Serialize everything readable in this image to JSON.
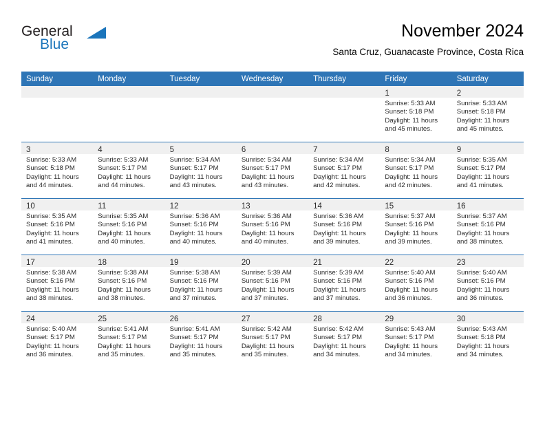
{
  "brand": {
    "name_part1": "General",
    "name_part2": "Blue",
    "color_primary": "#1b75bb",
    "color_text": "#231f20",
    "triangle_icon": "triangle-icon"
  },
  "header": {
    "title": "November 2024",
    "subtitle": "Santa Cruz, Guanacaste Province, Costa Rica"
  },
  "theme": {
    "header_bg": "#2e75b6",
    "header_text": "#ffffff",
    "daynum_band_bg": "#f0f0f0",
    "cell_bg": "#ffffff",
    "cell_border": "#2e75b6"
  },
  "weekdays": [
    "Sunday",
    "Monday",
    "Tuesday",
    "Wednesday",
    "Thursday",
    "Friday",
    "Saturday"
  ],
  "weeks": [
    [
      {
        "day": "",
        "lines": []
      },
      {
        "day": "",
        "lines": []
      },
      {
        "day": "",
        "lines": []
      },
      {
        "day": "",
        "lines": []
      },
      {
        "day": "",
        "lines": []
      },
      {
        "day": "1",
        "lines": [
          "Sunrise: 5:33 AM",
          "Sunset: 5:18 PM",
          "Daylight: 11 hours",
          "and 45 minutes."
        ]
      },
      {
        "day": "2",
        "lines": [
          "Sunrise: 5:33 AM",
          "Sunset: 5:18 PM",
          "Daylight: 11 hours",
          "and 45 minutes."
        ]
      }
    ],
    [
      {
        "day": "3",
        "lines": [
          "Sunrise: 5:33 AM",
          "Sunset: 5:18 PM",
          "Daylight: 11 hours",
          "and 44 minutes."
        ]
      },
      {
        "day": "4",
        "lines": [
          "Sunrise: 5:33 AM",
          "Sunset: 5:17 PM",
          "Daylight: 11 hours",
          "and 44 minutes."
        ]
      },
      {
        "day": "5",
        "lines": [
          "Sunrise: 5:34 AM",
          "Sunset: 5:17 PM",
          "Daylight: 11 hours",
          "and 43 minutes."
        ]
      },
      {
        "day": "6",
        "lines": [
          "Sunrise: 5:34 AM",
          "Sunset: 5:17 PM",
          "Daylight: 11 hours",
          "and 43 minutes."
        ]
      },
      {
        "day": "7",
        "lines": [
          "Sunrise: 5:34 AM",
          "Sunset: 5:17 PM",
          "Daylight: 11 hours",
          "and 42 minutes."
        ]
      },
      {
        "day": "8",
        "lines": [
          "Sunrise: 5:34 AM",
          "Sunset: 5:17 PM",
          "Daylight: 11 hours",
          "and 42 minutes."
        ]
      },
      {
        "day": "9",
        "lines": [
          "Sunrise: 5:35 AM",
          "Sunset: 5:17 PM",
          "Daylight: 11 hours",
          "and 41 minutes."
        ]
      }
    ],
    [
      {
        "day": "10",
        "lines": [
          "Sunrise: 5:35 AM",
          "Sunset: 5:16 PM",
          "Daylight: 11 hours",
          "and 41 minutes."
        ]
      },
      {
        "day": "11",
        "lines": [
          "Sunrise: 5:35 AM",
          "Sunset: 5:16 PM",
          "Daylight: 11 hours",
          "and 40 minutes."
        ]
      },
      {
        "day": "12",
        "lines": [
          "Sunrise: 5:36 AM",
          "Sunset: 5:16 PM",
          "Daylight: 11 hours",
          "and 40 minutes."
        ]
      },
      {
        "day": "13",
        "lines": [
          "Sunrise: 5:36 AM",
          "Sunset: 5:16 PM",
          "Daylight: 11 hours",
          "and 40 minutes."
        ]
      },
      {
        "day": "14",
        "lines": [
          "Sunrise: 5:36 AM",
          "Sunset: 5:16 PM",
          "Daylight: 11 hours",
          "and 39 minutes."
        ]
      },
      {
        "day": "15",
        "lines": [
          "Sunrise: 5:37 AM",
          "Sunset: 5:16 PM",
          "Daylight: 11 hours",
          "and 39 minutes."
        ]
      },
      {
        "day": "16",
        "lines": [
          "Sunrise: 5:37 AM",
          "Sunset: 5:16 PM",
          "Daylight: 11 hours",
          "and 38 minutes."
        ]
      }
    ],
    [
      {
        "day": "17",
        "lines": [
          "Sunrise: 5:38 AM",
          "Sunset: 5:16 PM",
          "Daylight: 11 hours",
          "and 38 minutes."
        ]
      },
      {
        "day": "18",
        "lines": [
          "Sunrise: 5:38 AM",
          "Sunset: 5:16 PM",
          "Daylight: 11 hours",
          "and 38 minutes."
        ]
      },
      {
        "day": "19",
        "lines": [
          "Sunrise: 5:38 AM",
          "Sunset: 5:16 PM",
          "Daylight: 11 hours",
          "and 37 minutes."
        ]
      },
      {
        "day": "20",
        "lines": [
          "Sunrise: 5:39 AM",
          "Sunset: 5:16 PM",
          "Daylight: 11 hours",
          "and 37 minutes."
        ]
      },
      {
        "day": "21",
        "lines": [
          "Sunrise: 5:39 AM",
          "Sunset: 5:16 PM",
          "Daylight: 11 hours",
          "and 37 minutes."
        ]
      },
      {
        "day": "22",
        "lines": [
          "Sunrise: 5:40 AM",
          "Sunset: 5:16 PM",
          "Daylight: 11 hours",
          "and 36 minutes."
        ]
      },
      {
        "day": "23",
        "lines": [
          "Sunrise: 5:40 AM",
          "Sunset: 5:16 PM",
          "Daylight: 11 hours",
          "and 36 minutes."
        ]
      }
    ],
    [
      {
        "day": "24",
        "lines": [
          "Sunrise: 5:40 AM",
          "Sunset: 5:17 PM",
          "Daylight: 11 hours",
          "and 36 minutes."
        ]
      },
      {
        "day": "25",
        "lines": [
          "Sunrise: 5:41 AM",
          "Sunset: 5:17 PM",
          "Daylight: 11 hours",
          "and 35 minutes."
        ]
      },
      {
        "day": "26",
        "lines": [
          "Sunrise: 5:41 AM",
          "Sunset: 5:17 PM",
          "Daylight: 11 hours",
          "and 35 minutes."
        ]
      },
      {
        "day": "27",
        "lines": [
          "Sunrise: 5:42 AM",
          "Sunset: 5:17 PM",
          "Daylight: 11 hours",
          "and 35 minutes."
        ]
      },
      {
        "day": "28",
        "lines": [
          "Sunrise: 5:42 AM",
          "Sunset: 5:17 PM",
          "Daylight: 11 hours",
          "and 34 minutes."
        ]
      },
      {
        "day": "29",
        "lines": [
          "Sunrise: 5:43 AM",
          "Sunset: 5:17 PM",
          "Daylight: 11 hours",
          "and 34 minutes."
        ]
      },
      {
        "day": "30",
        "lines": [
          "Sunrise: 5:43 AM",
          "Sunset: 5:18 PM",
          "Daylight: 11 hours",
          "and 34 minutes."
        ]
      }
    ]
  ]
}
